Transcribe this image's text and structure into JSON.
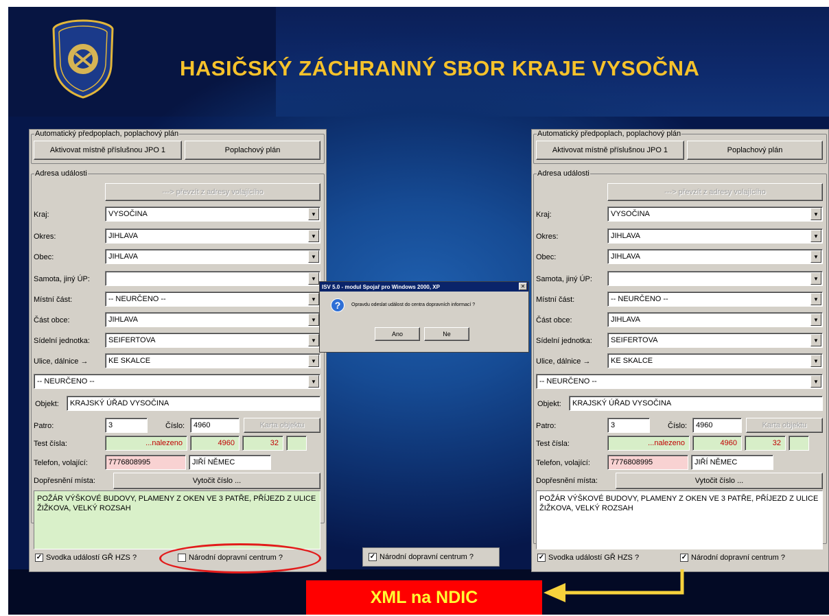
{
  "slide": {
    "title": "HASIČSKÝ ZÁCHRANNÝ SBOR KRAJE VYSOČNA",
    "title_color": "#f6c22b"
  },
  "left_form": {
    "group_alarm": "Automatický předpoplach, poplachový plán",
    "btn_activate": "Aktivovat místně příslušnou JPO 1",
    "btn_plan": "Poplachový plán",
    "group_address": "Adresa události",
    "btn_convert": "---> převzít z adresy volajícího",
    "kraj_label": "Kraj:",
    "kraj_value": "VYSOČINA",
    "okres_label": "Okres:",
    "okres_value": "JIHLAVA",
    "obec_label": "Obec:",
    "obec_value": "JIHLAVA",
    "samota_label": "Samota, jiný ÚP:",
    "samota_value": "",
    "mistni_label": "Místní část:",
    "mistni_value": "-- NEURČENO --",
    "cast_label": "Část obce:",
    "cast_value": "JIHLAVA",
    "sidelni_label": "Sídelní jednotka:",
    "sidelni_value": "SEIFERTOVA",
    "ulice_label": "Ulice, dálnice →",
    "ulice_value": "KE SKALCE",
    "neurceno_value": "-- NEURČENO --",
    "objekt_label": "Objekt:",
    "objekt_value": "KRAJSKÝ ÚŘAD VYSOČINA",
    "patro_label": "Patro:",
    "patro_value": "3",
    "cislo_label": "Číslo:",
    "cislo_value": "4960",
    "btn_karta": "Karta objektu",
    "test_label": "Test čísla:",
    "test_value": "...nalezeno",
    "test_num": "4960",
    "test_num2": "32",
    "telefon_label": "Telefon, volající:",
    "telefon_value": "7776808995",
    "volajici_value": "JIŘÍ NĚMEC",
    "dopresneni_label": "Dopřesnění místa:",
    "btn_vytocit": "Vytočit číslo ...",
    "note": "POŽÁR VÝŠKOVÉ BUDOVY, PLAMENY Z OKEN VE 3 PATŘE, PŘÍJEZD Z ULICE ŽIŽKOVA, VELKÝ ROZSAH",
    "chk_svodka": "Svodka událostí GŘ HZS ?",
    "chk_svodka_checked": true,
    "chk_ndic": "Národní dopravní centrum ?",
    "chk_ndic_checked": false
  },
  "right_form": {
    "group_alarm": "Automatický předpoplach, poplachový plán",
    "btn_activate": "Aktivovat místně příslušnou JPO 1",
    "btn_plan": "Poplachový plán",
    "group_address": "Adresa události",
    "btn_convert": "---> převzít z adresy volajícího",
    "kraj_label": "Kraj:",
    "kraj_value": "VYSOČINA",
    "okres_label": "Okres:",
    "okres_value": "JIHLAVA",
    "obec_label": "Obec:",
    "obec_value": "JIHLAVA",
    "samota_label": "Samota, jiný ÚP:",
    "samota_value": "",
    "mistni_label": "Místní část:",
    "mistni_value": "-- NEURČENO --",
    "cast_label": "Část obce:",
    "cast_value": "JIHLAVA",
    "sidelni_label": "Sídelní jednotka:",
    "sidelni_value": "SEIFERTOVA",
    "ulice_label": "Ulice, dálnice →",
    "ulice_value": "KE SKALCE",
    "neurceno_value": "-- NEURČENO --",
    "objekt_label": "Objekt:",
    "objekt_value": "KRAJSKÝ ÚŘAD VYSOČINA",
    "patro_label": "Patro:",
    "patro_value": "3",
    "cislo_label": "Číslo:",
    "cislo_value": "4960",
    "btn_karta": "Karta objektu",
    "test_label": "Test čísla:",
    "test_value": "...nalezeno",
    "test_num": "4960",
    "test_num2": "32",
    "telefon_label": "Telefon, volající:",
    "telefon_value": "7776808995",
    "volajici_value": "JIŘÍ NĚMEC",
    "dopresneni_label": "Dopřesnění místa:",
    "btn_vytocit": "Vytočit číslo ...",
    "note": "POŽÁR VÝŠKOVÉ BUDOVY, PLAMENY Z OKEN VE 3 PATŘE, PŘÍJEZD Z ULICE ŽIŽKOVA, VELKÝ ROZSAH",
    "chk_svodka": "Svodka událostí GŘ HZS ?",
    "chk_svodka_checked": true,
    "chk_ndic": "Národní dopravní centrum ?",
    "chk_ndic_checked": true
  },
  "dialog": {
    "title": "ISV 5.0 - modul Spojař pro Windows 2000, XP",
    "message": "Opravdu odeslat událost do centra dopravních informací ?",
    "btn_yes": "Ano",
    "btn_no": "Ne"
  },
  "middle_checkbox": {
    "label": "Národní dopravní centrum ?",
    "checked": true
  },
  "callout": {
    "label": "XML na NDIC"
  }
}
